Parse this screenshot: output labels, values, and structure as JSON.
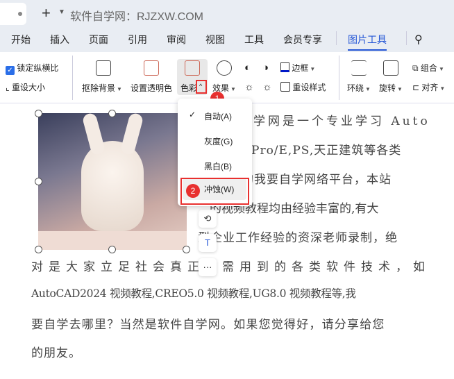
{
  "titlebar": {
    "doc_title": "软件自学网：RJZXW.COM",
    "new_tab": "+",
    "more": "⌄"
  },
  "menu": [
    "开始",
    "插入",
    "页面",
    "引用",
    "审阅",
    "视图",
    "工具",
    "会员专享",
    "图片工具"
  ],
  "active_menu": "图片工具",
  "ribbon": {
    "lock_ratio": "锁定纵横比",
    "lock_checked": true,
    "resize": "重设大小",
    "remove_bg": "抠除背景",
    "transparent": "设置透明色",
    "color": "色彩",
    "effects": "效果",
    "border": "边框",
    "reset_style": "重设样式",
    "wrap": "环绕",
    "rotate": "旋转",
    "group": "组合",
    "align": "对齐"
  },
  "color_menu": {
    "items": [
      {
        "label": "自动(A)",
        "checked": true
      },
      {
        "label": "灰度(G)",
        "checked": false
      },
      {
        "label": "黑白(B)",
        "checked": false
      },
      {
        "label": "冲蚀(W)",
        "checked": false
      }
    ]
  },
  "badges": [
    "1",
    "2"
  ],
  "document": {
    "lines": [
      "学网是一个专业学习 Auto",
      "Pro/E,PS,天正建筑等各类",
      "的我要自学网络平台，本站",
      "的视频教程均由经验丰富的,有大",
      "型企业工作经验的资深老师录制，绝",
      "对是大家立足社会真正需需用到的各类软件技术，如",
      "AutoCAD2024 视频教程,CREO5.0 视频教程,UG8.0 视频教程等,我",
      "要自学去哪里？当然是软件自学网。如果您觉得好，请分享给您",
      "的朋友。"
    ]
  },
  "colors": {
    "accent": "#2456d6",
    "highlight": "#e8302f"
  }
}
